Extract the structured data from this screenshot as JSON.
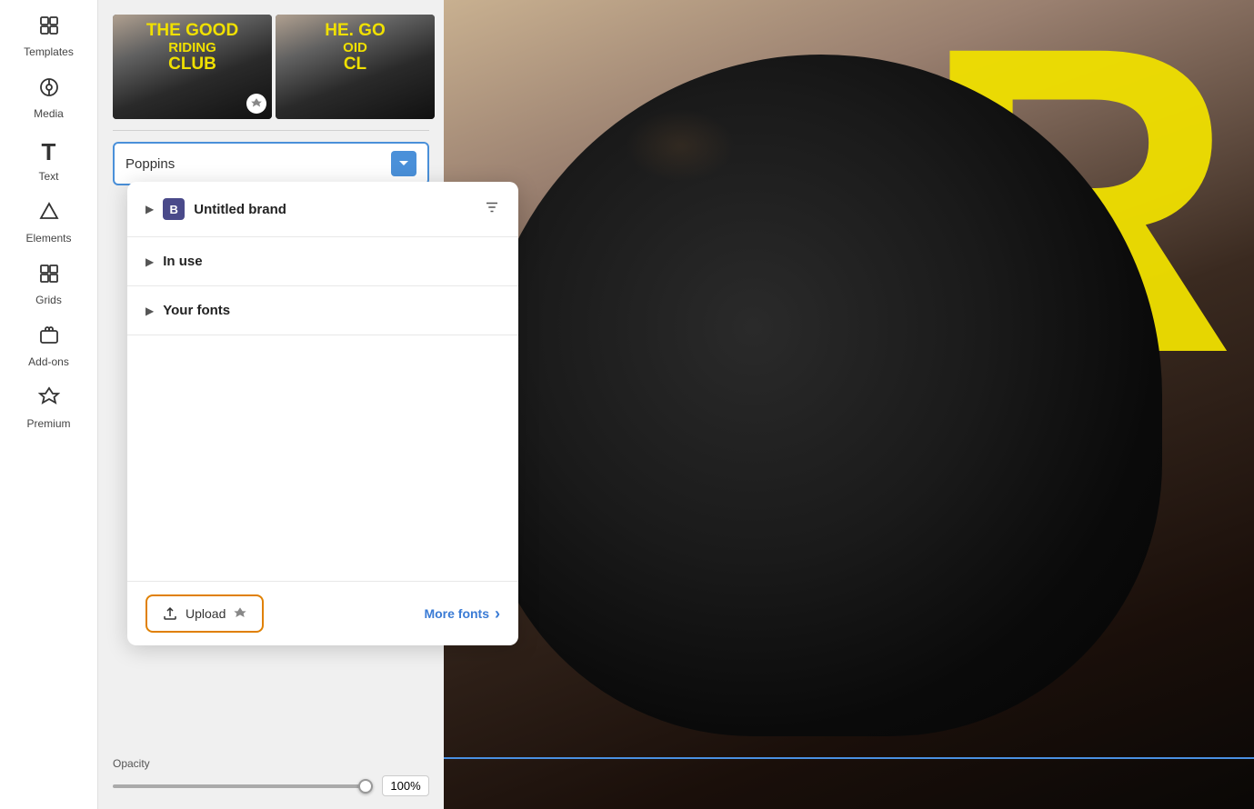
{
  "sidebar": {
    "items": [
      {
        "id": "templates",
        "label": "Templates",
        "icon": "⊞"
      },
      {
        "id": "media",
        "label": "Media",
        "icon": "⊛"
      },
      {
        "id": "text",
        "label": "Text",
        "icon": "T"
      },
      {
        "id": "elements",
        "label": "Elements",
        "icon": "✦"
      },
      {
        "id": "grids",
        "label": "Grids",
        "icon": "▦"
      },
      {
        "id": "addons",
        "label": "Add-ons",
        "icon": "🎁"
      },
      {
        "id": "premium",
        "label": "Premium",
        "icon": "★"
      }
    ]
  },
  "thumbnail1": {
    "line1": "THE GOOD",
    "line2": "RIDING",
    "line3": "CLUB"
  },
  "thumbnail2": {
    "line1": "HE. GO",
    "line2": "OID",
    "line3": "CL"
  },
  "font_selector": {
    "current_font": "Poppins",
    "dropdown_placeholder": "Poppins"
  },
  "font_popup": {
    "sections": [
      {
        "id": "untitled-brand",
        "title": "Untitled brand",
        "has_brand_icon": true,
        "has_filter": true,
        "chevron": "▶"
      },
      {
        "id": "in-use",
        "title": "In use",
        "has_brand_icon": false,
        "has_filter": false,
        "chevron": "▶"
      },
      {
        "id": "your-fonts",
        "title": "Your fonts",
        "has_brand_icon": false,
        "has_filter": false,
        "chevron": "▶"
      }
    ],
    "footer": {
      "upload_label": "Upload",
      "more_fonts_label": "More fonts",
      "more_fonts_icon": "›"
    }
  },
  "bottom": {
    "opacity_label": "Opacity",
    "opacity_value": "100%",
    "slider_percent": 100
  },
  "yellow_letter": "R"
}
